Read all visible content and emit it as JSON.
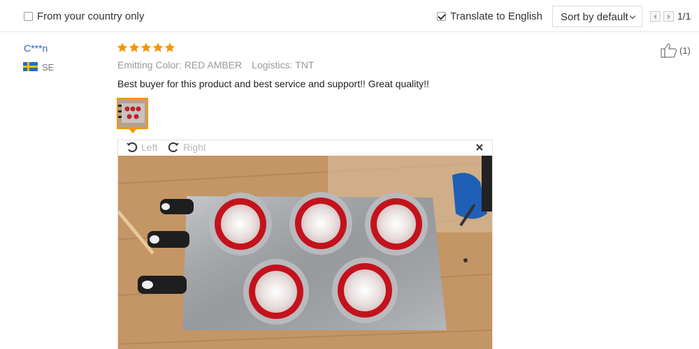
{
  "filters": {
    "country_only_label": "From your country only",
    "country_only_checked": false,
    "translate_label": "Translate to English",
    "translate_checked": true,
    "sort_label": "Sort by default",
    "page_indicator": "1/1"
  },
  "review": {
    "reviewer_name": "C***n",
    "country_code": "SE",
    "rating": 5,
    "emitting_color": "Emitting Color: RED AMBER",
    "logistics": "Logistics: TNT",
    "text": "Best buyer for this product and best service and support!! Great quality!!",
    "helpful_count": "(1)"
  },
  "viewer": {
    "rotate_left_label": "Left",
    "rotate_right_label": "Right"
  },
  "colors": {
    "star": "#f39800",
    "link": "#2a63b8",
    "thumb_border": "#f39800"
  }
}
